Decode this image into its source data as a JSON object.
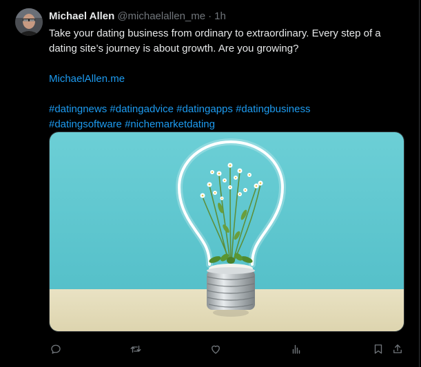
{
  "author": {
    "display_name": "Michael Allen",
    "handle": "@michaelallen_me",
    "separator": "·",
    "time": "1h"
  },
  "tweet": {
    "text": "Take your dating business from ordinary to extraordinary. Every step of a dating site’s journey is about growth. Are you growing?",
    "link": "MichaelAllen.me",
    "hashtags": [
      "#datingnews",
      "#datingadvice",
      "#datingapps",
      "#datingbusiness",
      "#datingsoftware",
      "#nichemarketdating"
    ]
  },
  "media": {
    "description_icon": "lightbulb-with-plant-image"
  },
  "actions": [
    {
      "name": "reply",
      "icon": "reply-icon"
    },
    {
      "name": "repost",
      "icon": "repost-icon"
    },
    {
      "name": "like",
      "icon": "like-icon"
    },
    {
      "name": "views",
      "icon": "views-icon"
    },
    {
      "name": "bookmark",
      "icon": "bookmark-icon"
    },
    {
      "name": "share",
      "icon": "share-icon"
    }
  ],
  "colors": {
    "background": "#000000",
    "text": "#e7e9ea",
    "secondary_text": "#71767b",
    "link": "#1d9bf0",
    "image_sky": "#5ec6cf",
    "image_table": "#e6dfc0"
  }
}
